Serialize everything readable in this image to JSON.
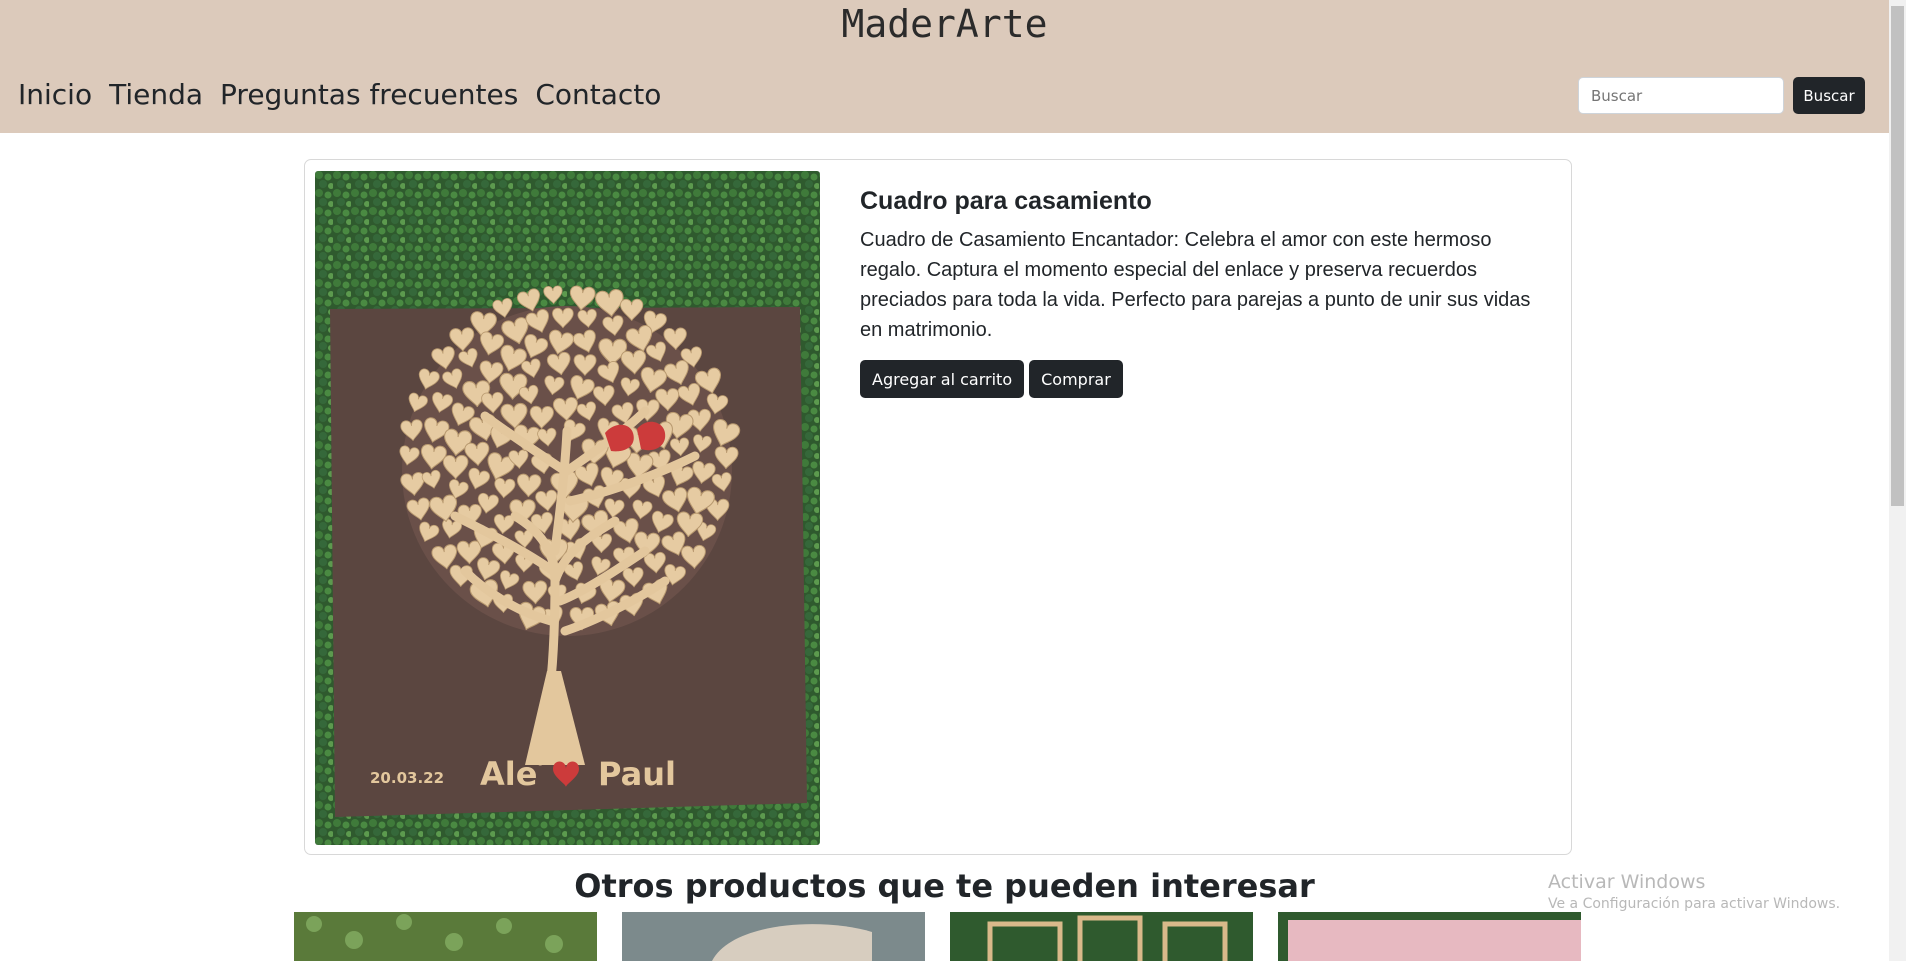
{
  "header": {
    "brand": "MaderArte",
    "nav": [
      "Inicio",
      "Tienda",
      "Preguntas frecuentes",
      "Contacto"
    ],
    "search_placeholder": "Buscar",
    "search_button": "Buscar"
  },
  "product": {
    "title": "Cuadro para casamiento",
    "description": "Cuadro de Casamiento Encantador: Celebra el amor con este hermoso regalo. Captura el momento especial del enlace y preserva recuerdos preciados para toda la vida. Perfecto para parejas a punto de unir sus vidas en matrimonio.",
    "add_to_cart": "Agregar al carrito",
    "buy": "Comprar",
    "image_text": {
      "date": "20.03.22",
      "name_left": "Ale",
      "name_right": "Paul"
    }
  },
  "related": {
    "title": "Otros productos que te pueden interesar"
  },
  "watermark": {
    "title": "Activar Windows",
    "subtitle": "Ve a Configuración para activar Windows."
  },
  "colors": {
    "header_bg": "#dccabb",
    "button_dark": "#212529",
    "board": "#5b4640",
    "wood": "#e3c79d",
    "hedge": "#2f5a2e",
    "accent_red": "#cc3b3b"
  }
}
